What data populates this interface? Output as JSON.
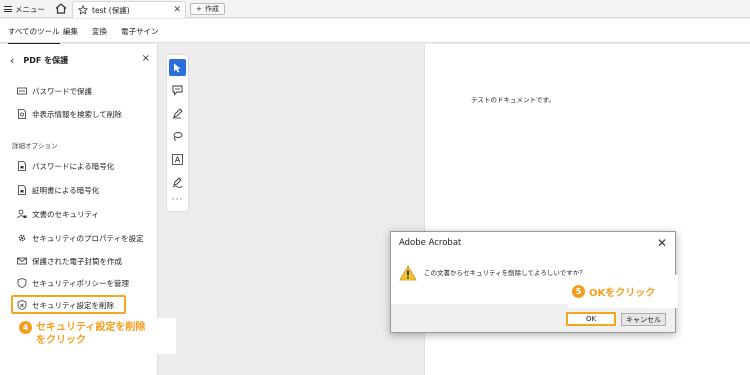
{
  "tabbar": {
    "menu_label": "メニュー",
    "doc_tab_label": "test (保護)",
    "new_tab_label": "作成"
  },
  "tool_tabs": [
    "すべてのツール",
    "編集",
    "変換",
    "電子サイン"
  ],
  "panel": {
    "title": "PDF を保護",
    "items_top": [
      "パスワードで保護",
      "非表示情報を検索して削除"
    ],
    "section_label": "詳細オプション",
    "items_advanced": [
      "パスワードによる暗号化",
      "証明書による暗号化",
      "文書のセキュリティ",
      "セキュリティのプロパティを設定",
      "保護された電子封筒を作成",
      "セキュリティポリシーを管理",
      "セキュリティ設定を削除"
    ]
  },
  "callouts": {
    "step4_number": "4",
    "step4_line1": "セキュリティ設定を削除",
    "step4_line2": "をクリック",
    "step5_number": "5",
    "step5_text": "OKをクリック"
  },
  "document": {
    "text": "テストのドキュメントです。"
  },
  "dialog": {
    "title": "Adobe Acrobat",
    "message": "この文書からセキュリティを削除してよろしいですか？",
    "ok_label": "OK",
    "cancel_label": "キャンセル"
  },
  "colors": {
    "accent": "#f59c1a",
    "highlight_border": "#f5a623",
    "tool_active": "#2b6fdc"
  }
}
